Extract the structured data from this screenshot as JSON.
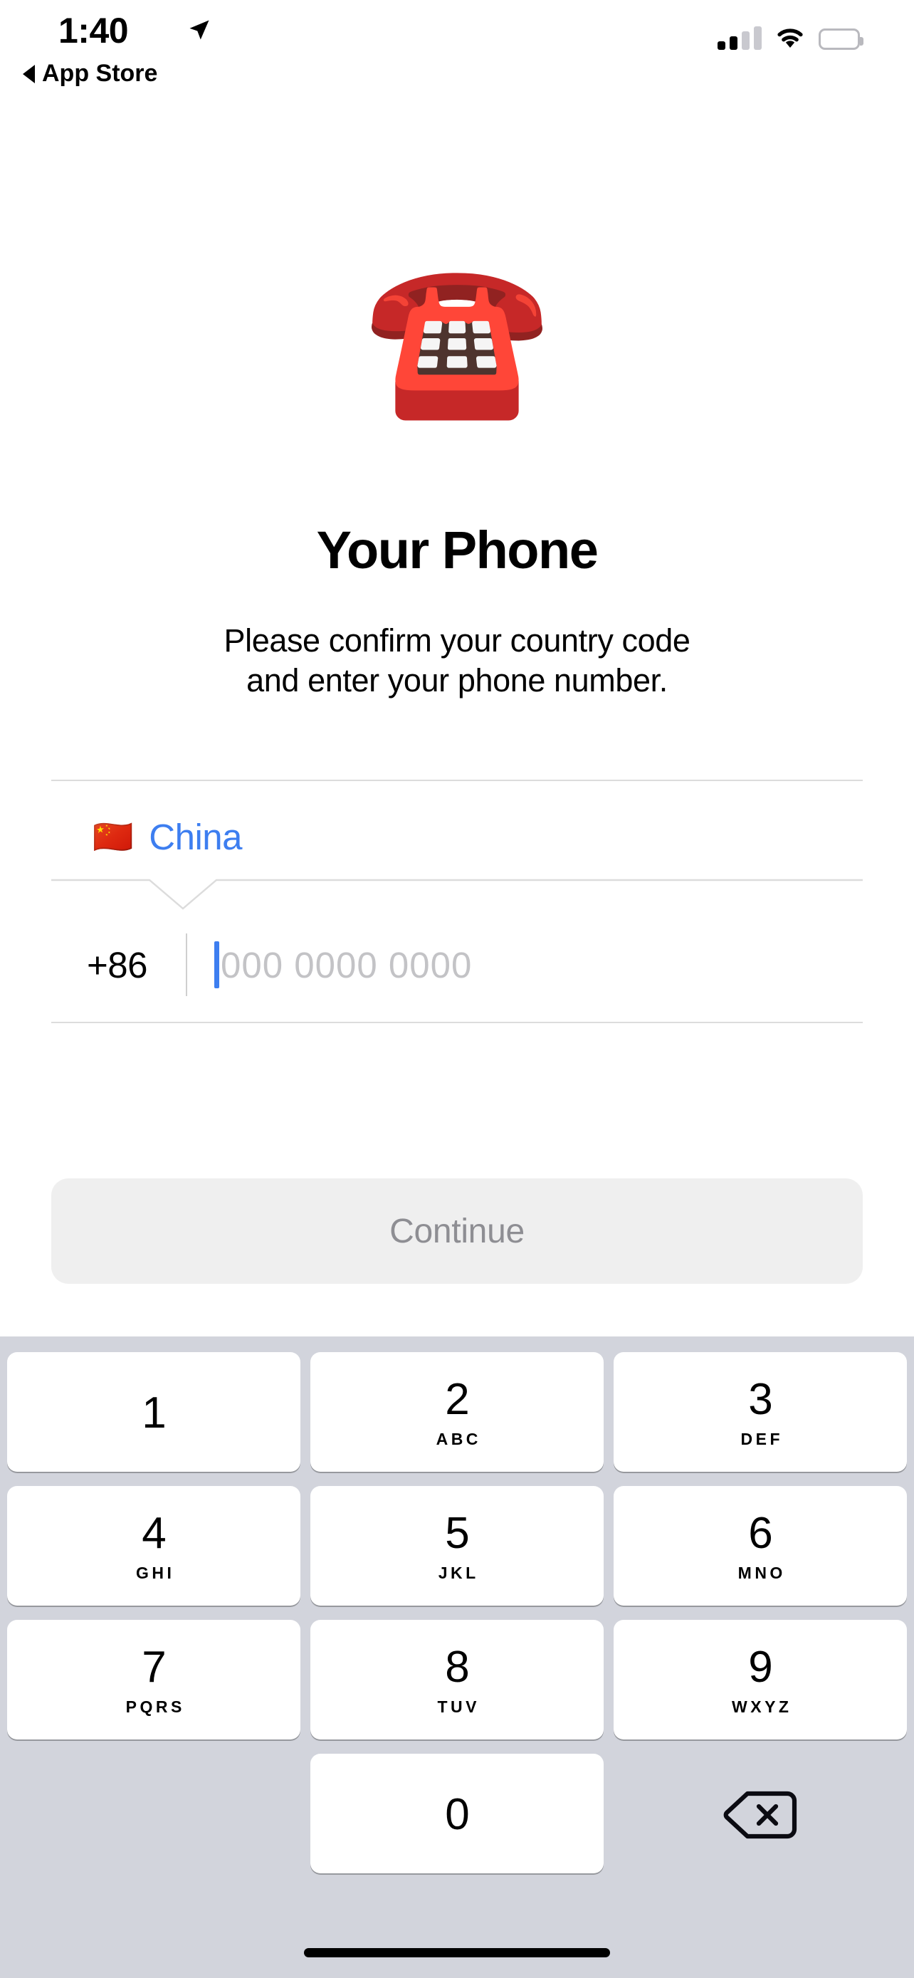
{
  "status_bar": {
    "time": "1:40",
    "location_icon": "location-arrow-icon",
    "back_label": "App Store",
    "signal_icon": "cellular-signal-icon",
    "signal_bars_filled": 2,
    "signal_bars_total": 4,
    "wifi_icon": "wifi-icon",
    "battery_icon": "battery-icon"
  },
  "hero": {
    "emoji": "☎️",
    "emoji_name": "telephone-emoji",
    "title": "Your Phone",
    "subtitle_line1": "Please confirm your country code",
    "subtitle_line2": "and enter your phone number."
  },
  "form": {
    "country": {
      "flag": "🇨🇳",
      "flag_name": "china-flag-emoji",
      "name": "China"
    },
    "dial_code": "+86",
    "phone_value": "",
    "phone_placeholder": "000 0000 0000",
    "accent_color": "#3d7ef0",
    "placeholder_color": "#c3c3c6"
  },
  "actions": {
    "continue_label": "Continue",
    "continue_enabled": false,
    "continue_bg": "#efefef",
    "continue_text_color": "#8e8e93"
  },
  "keyboard": {
    "background_color": "#d2d4dc",
    "keys": [
      {
        "num": "1",
        "letters": ""
      },
      {
        "num": "2",
        "letters": "ABC"
      },
      {
        "num": "3",
        "letters": "DEF"
      },
      {
        "num": "4",
        "letters": "GHI"
      },
      {
        "num": "5",
        "letters": "JKL"
      },
      {
        "num": "6",
        "letters": "MNO"
      },
      {
        "num": "7",
        "letters": "PQRS"
      },
      {
        "num": "8",
        "letters": "TUV"
      },
      {
        "num": "9",
        "letters": "WXYZ"
      },
      {
        "num": "0",
        "letters": ""
      }
    ],
    "delete_icon": "delete-backspace-icon"
  }
}
